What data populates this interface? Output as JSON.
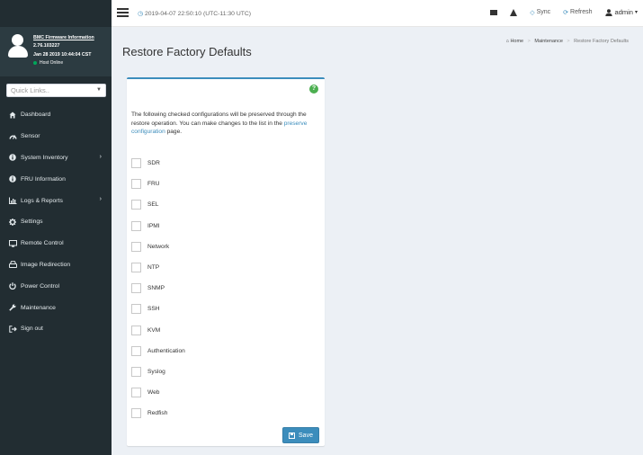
{
  "header": {
    "datetime": "2019-04-07 22:50:10 (UTC-11:30 UTC)",
    "sync_label": "Sync",
    "refresh_label": "Refresh",
    "user_label": "admin"
  },
  "user_panel": {
    "fw_link": "BMC Firmware Information",
    "version": "2.76.103227",
    "build_date": "Jan 28 2019 10:44:04 CST",
    "host_status": "Host Online"
  },
  "quick_links": {
    "placeholder": "Quick Links.."
  },
  "menu": [
    {
      "label": "Dashboard",
      "icon": "dashboard-icon",
      "has_children": false
    },
    {
      "label": "Sensor",
      "icon": "sensor-icon",
      "has_children": false
    },
    {
      "label": "System Inventory",
      "icon": "info-icon",
      "has_children": true
    },
    {
      "label": "FRU Information",
      "icon": "info-icon",
      "has_children": false
    },
    {
      "label": "Logs & Reports",
      "icon": "chart-icon",
      "has_children": true
    },
    {
      "label": "Settings",
      "icon": "gear-icon",
      "has_children": false
    },
    {
      "label": "Remote Control",
      "icon": "monitor-icon",
      "has_children": false
    },
    {
      "label": "Image Redirection",
      "icon": "drive-icon",
      "has_children": false
    },
    {
      "label": "Power Control",
      "icon": "power-icon",
      "has_children": false
    },
    {
      "label": "Maintenance",
      "icon": "wrench-icon",
      "has_children": false
    },
    {
      "label": "Sign out",
      "icon": "sign-out-icon",
      "has_children": false
    }
  ],
  "page": {
    "title": "Restore Factory Defaults",
    "breadcrumb": {
      "home": "Home",
      "section": "Maintenance",
      "current": "Restore Factory Defaults"
    }
  },
  "box": {
    "desc_prefix": "The following checked configurations will be preserved through the restore operation. You can make changes to the list in the ",
    "desc_link": "preserve configuration",
    "desc_suffix": " page.",
    "items": [
      {
        "label": "SDR",
        "checked": false
      },
      {
        "label": "FRU",
        "checked": false
      },
      {
        "label": "SEL",
        "checked": false
      },
      {
        "label": "IPMI",
        "checked": false
      },
      {
        "label": "Network",
        "checked": false
      },
      {
        "label": "NTP",
        "checked": false
      },
      {
        "label": "SNMP",
        "checked": false
      },
      {
        "label": "SSH",
        "checked": false
      },
      {
        "label": "KVM",
        "checked": false
      },
      {
        "label": "Authentication",
        "checked": false
      },
      {
        "label": "Syslog",
        "checked": false
      },
      {
        "label": "Web",
        "checked": false
      },
      {
        "label": "Redfish",
        "checked": false
      }
    ],
    "save_label": "Save"
  },
  "colors": {
    "sidebar_bg": "#222d32",
    "accent": "#3c8dbc",
    "content_bg": "#ecf0f5",
    "help_green": "#4caf50"
  }
}
